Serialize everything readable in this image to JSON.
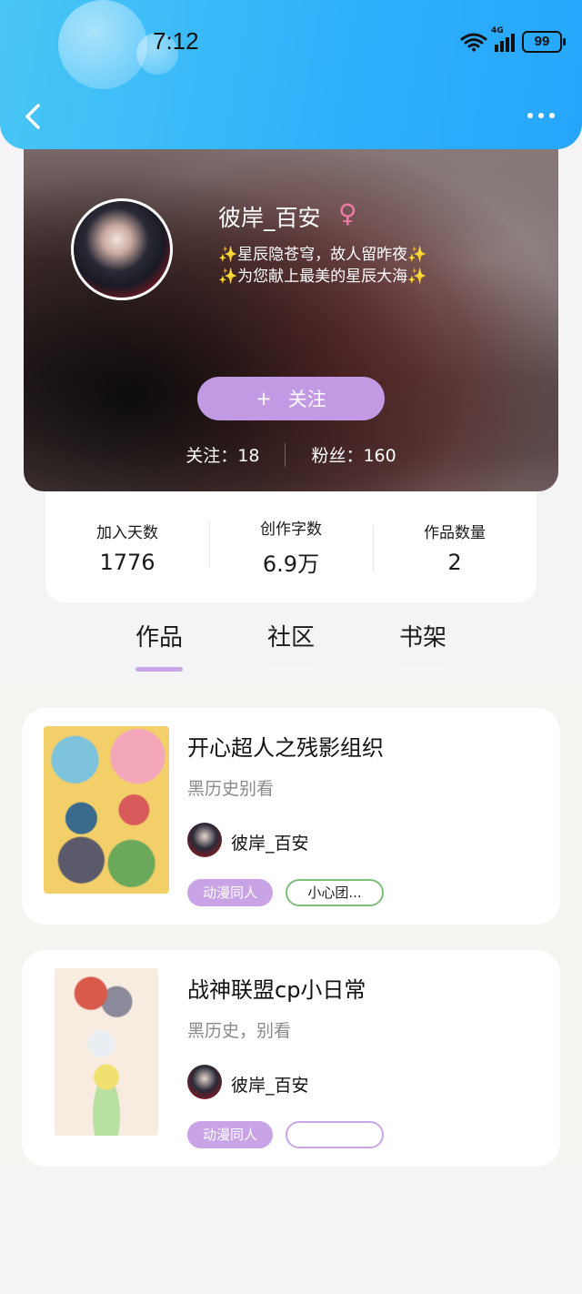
{
  "status_bar": {
    "time": "7:12",
    "network": "4G",
    "battery": "99"
  },
  "profile": {
    "username": "彼岸_百安",
    "gender_symbol": "♀",
    "bio_line1": "✨星辰隐苍穹，故人留昨夜✨",
    "bio_line2": "✨为您献上最美的星辰大海✨",
    "follow_plus": "+",
    "follow_label": "关注",
    "following_label": "关注：",
    "following_count": "18",
    "fans_label": "粉丝：",
    "fans_count": "160"
  },
  "stats": [
    {
      "label": "加入天数",
      "value": "1776"
    },
    {
      "label": "创作字数",
      "value": "6.9万"
    },
    {
      "label": "作品数量",
      "value": "2"
    }
  ],
  "tabs": [
    {
      "label": "作品",
      "active": true
    },
    {
      "label": "社区",
      "active": false
    },
    {
      "label": "书架",
      "active": false
    }
  ],
  "works": [
    {
      "title": "开心超人之残影组织",
      "subtitle": "黑历史别看",
      "author": "彼岸_百安",
      "tag1": "动漫同人",
      "tag2": "小心团..."
    },
    {
      "title": "战神联盟cp小日常",
      "subtitle": "黑历史，别看",
      "author": "彼岸_百安",
      "tag1": "动漫同人",
      "tag2": ""
    }
  ],
  "colors": {
    "header": "#2fb0fb",
    "accent_purple": "#c19ae3",
    "tag_green": "#7cbf7a",
    "tag_lilac": "#c9a6e6"
  }
}
